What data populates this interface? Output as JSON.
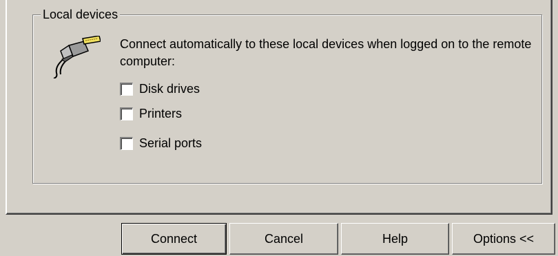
{
  "group": {
    "title": "Local devices",
    "description": "Connect automatically to these local devices when logged on to the remote computer:"
  },
  "icons": {
    "devices": "local-devices-plug-icon"
  },
  "options": [
    {
      "label": "Disk drives",
      "checked": false
    },
    {
      "label": "Printers",
      "checked": false
    },
    {
      "label": "Serial ports",
      "checked": false
    }
  ],
  "buttons": {
    "connect": "Connect",
    "cancel": "Cancel",
    "help": "Help",
    "options": "Options <<"
  }
}
